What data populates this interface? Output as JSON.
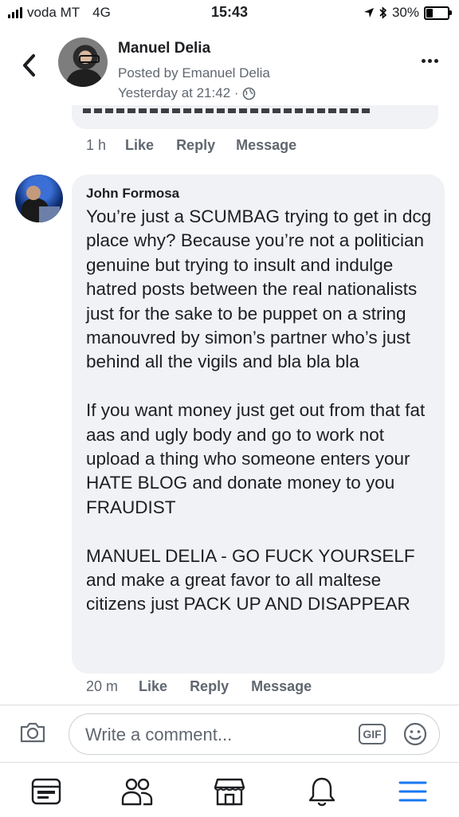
{
  "status_bar": {
    "carrier": "voda MT",
    "network": "4G",
    "time": "15:43",
    "battery": "30%"
  },
  "post_header": {
    "author": "Manuel Delia",
    "posted_by": "Posted by Emanuel Delia",
    "timestamp": "Yesterday at 21:42 ·"
  },
  "previous_comment": {
    "age": "1 h",
    "like": "Like",
    "reply": "Reply",
    "message": "Message"
  },
  "comment": {
    "author": "John Formosa",
    "paragraphs": [
      "You’re just a SCUMBAG trying to get in dcg place why? Because you’re not a politician genuine but trying to insult and indulge hatred posts between the real nationalists just for the sake to be puppet on a string manouvred by simon’s partner who’s just behind all the vigils and bla bla bla",
      "If you want money just get out from that fat aas and ugly body and go to work not upload a thing who someone enters your HATE BLOG and donate money to you FRAUDIST",
      "MANUEL DELIA - GO FUCK YOURSELF and make a great favor to all maltese citizens just PACK UP AND DISAPPEAR"
    ],
    "age": "20 m",
    "like": "Like",
    "reply": "Reply",
    "message": "Message"
  },
  "composer": {
    "placeholder": "Write a comment...",
    "gif_label": "GIF"
  },
  "tabs": [
    {
      "icon": "news-feed-icon"
    },
    {
      "icon": "friends-icon"
    },
    {
      "icon": "marketplace-icon"
    },
    {
      "icon": "notifications-bell-icon"
    },
    {
      "icon": "menu-icon"
    }
  ],
  "colors": {
    "bubble": "#f0f2f5",
    "secondary_text": "#606770",
    "menu_active": "#1877f2"
  }
}
